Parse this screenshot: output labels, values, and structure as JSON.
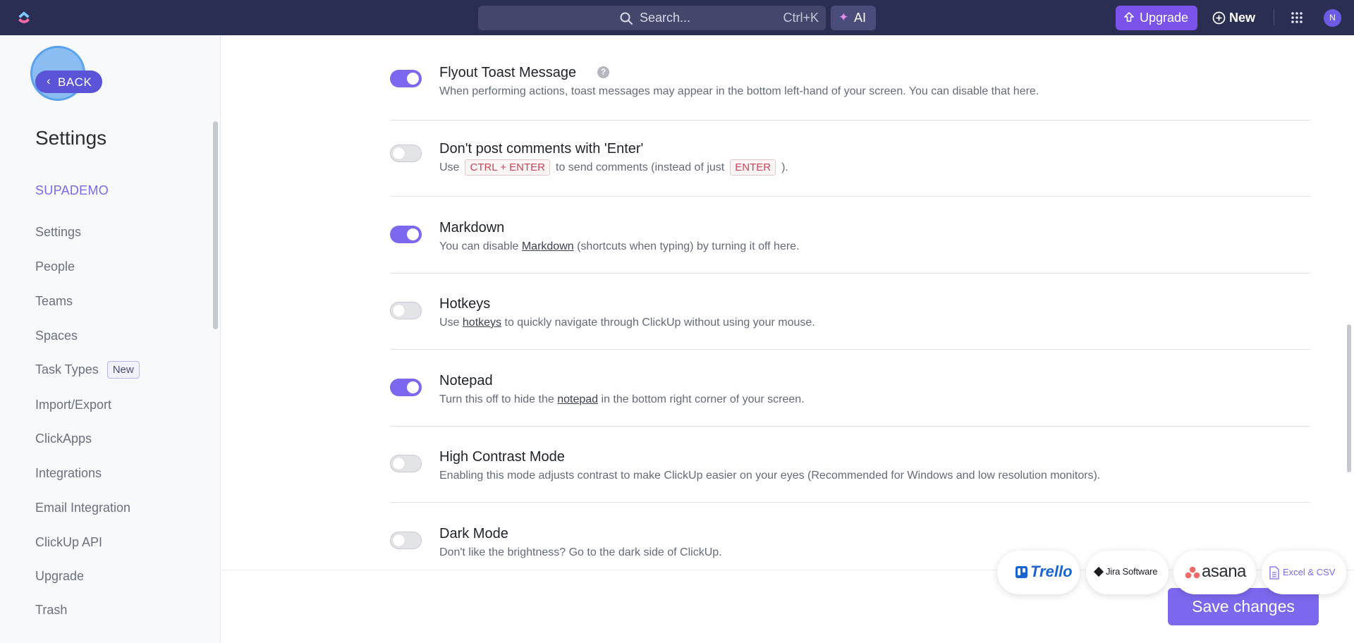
{
  "topbar": {
    "search_placeholder": "Search...",
    "search_shortcut": "Ctrl+K",
    "ai_label": "AI",
    "upgrade_label": "Upgrade",
    "new_label": "New",
    "avatar_initial": "N"
  },
  "sidebar": {
    "back_label": "BACK",
    "title": "Settings",
    "workspace": "SUPADEMO",
    "items": [
      {
        "label": "Settings"
      },
      {
        "label": "People"
      },
      {
        "label": "Teams"
      },
      {
        "label": "Spaces"
      },
      {
        "label": "Task Types",
        "badge": "New"
      },
      {
        "label": "Import/Export"
      },
      {
        "label": "ClickApps"
      },
      {
        "label": "Integrations"
      },
      {
        "label": "Email Integration"
      },
      {
        "label": "ClickUp API"
      },
      {
        "label": "Upgrade"
      },
      {
        "label": "Trash"
      }
    ]
  },
  "settings": [
    {
      "title": "Flyout Toast Message",
      "enabled": true,
      "desc": "When performing actions, toast messages may appear in the bottom left-hand of your screen. You can disable that here."
    },
    {
      "title": "Don't post comments with 'Enter'",
      "enabled": false,
      "desc_pre": "Use",
      "kbd1": "CTRL + ENTER",
      "desc_mid": "to send comments (instead of just",
      "kbd2": "ENTER",
      "desc_post": ")."
    },
    {
      "title": "Markdown",
      "enabled": true,
      "desc_pre": "You can disable ",
      "link": "Markdown",
      "desc_post": " (shortcuts when typing) by turning it off here."
    },
    {
      "title": "Hotkeys",
      "enabled": false,
      "desc_pre": "Use ",
      "link": "hotkeys",
      "desc_post": " to quickly navigate through ClickUp without using your mouse."
    },
    {
      "title": "Notepad",
      "enabled": true,
      "desc_pre": "Turn this off to hide the ",
      "link": "notepad",
      "desc_post": " in the bottom right corner of your screen."
    },
    {
      "title": "High Contrast Mode",
      "enabled": false,
      "desc": "Enabling this mode adjusts contrast to make ClickUp easier on your eyes (Recommended for Windows and low resolution monitors)."
    },
    {
      "title": "Dark Mode",
      "enabled": false,
      "desc": "Don't like the brightness? Go to the dark side of ClickUp."
    }
  ],
  "import_logos": {
    "trello": "Trello",
    "jira": "Jira Software",
    "asana": "asana",
    "excel": "Excel & CSV"
  },
  "save_label": "Save changes"
}
